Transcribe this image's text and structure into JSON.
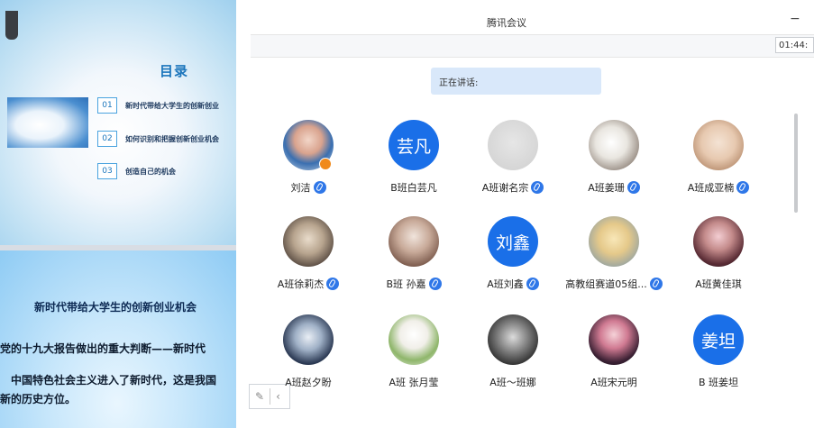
{
  "app": {
    "title": "腾讯会议",
    "timer": "01:44:"
  },
  "speaking": {
    "label": "正在讲话:"
  },
  "slide1": {
    "toc_title": "目录",
    "items": [
      {
        "num": "01",
        "text": "新时代带给大学生的创新创业"
      },
      {
        "num": "02",
        "text": "如何识别和把握创新创业机会"
      },
      {
        "num": "03",
        "text": "创造自己的机会"
      }
    ]
  },
  "slide2": {
    "title": "新时代带给大学生的创新创业机会",
    "line1": "党的十九大报告做出的重大判断——新时代",
    "line2": "中国特色社会主义进入了新时代，这是我国",
    "line3": "新的历史方位。"
  },
  "participants": [
    {
      "name": "刘洁",
      "avatar_text": "",
      "mic": true,
      "host": true
    },
    {
      "name": "B班白芸凡",
      "avatar_text": "芸凡",
      "mic": false
    },
    {
      "name": "A班谢名宗",
      "avatar_text": "",
      "mic": true
    },
    {
      "name": "A班姜珊",
      "avatar_text": "",
      "mic": true
    },
    {
      "name": "A班成亚楠",
      "avatar_text": "",
      "mic": true
    },
    {
      "name": "A班徐莉杰",
      "avatar_text": "",
      "mic": true
    },
    {
      "name": "B班 孙嘉",
      "avatar_text": "",
      "mic": true
    },
    {
      "name": "A班刘鑫",
      "avatar_text": "刘鑫",
      "mic": true
    },
    {
      "name": "高教组赛道05组...",
      "avatar_text": "",
      "mic": true
    },
    {
      "name": "A班黄佳琪",
      "avatar_text": "",
      "mic": false
    },
    {
      "name": "A班赵夕盼",
      "avatar_text": "",
      "mic": false
    },
    {
      "name": "A班 张月莹",
      "avatar_text": "",
      "mic": false
    },
    {
      "name": "A班～班娜",
      "avatar_text": "",
      "mic": false
    },
    {
      "name": "A班宋元明",
      "avatar_text": "",
      "mic": false
    },
    {
      "name": "B 班姜坦",
      "avatar_text": "姜坦",
      "mic": false
    }
  ],
  "colors": {
    "accent": "#1a6fe8",
    "speaking_bg": "#d9e8fa",
    "mic": "#2f77e8"
  },
  "icons": {
    "minimize": "minimize-icon",
    "mic": "microphone-icon",
    "host": "host-badge-icon"
  }
}
